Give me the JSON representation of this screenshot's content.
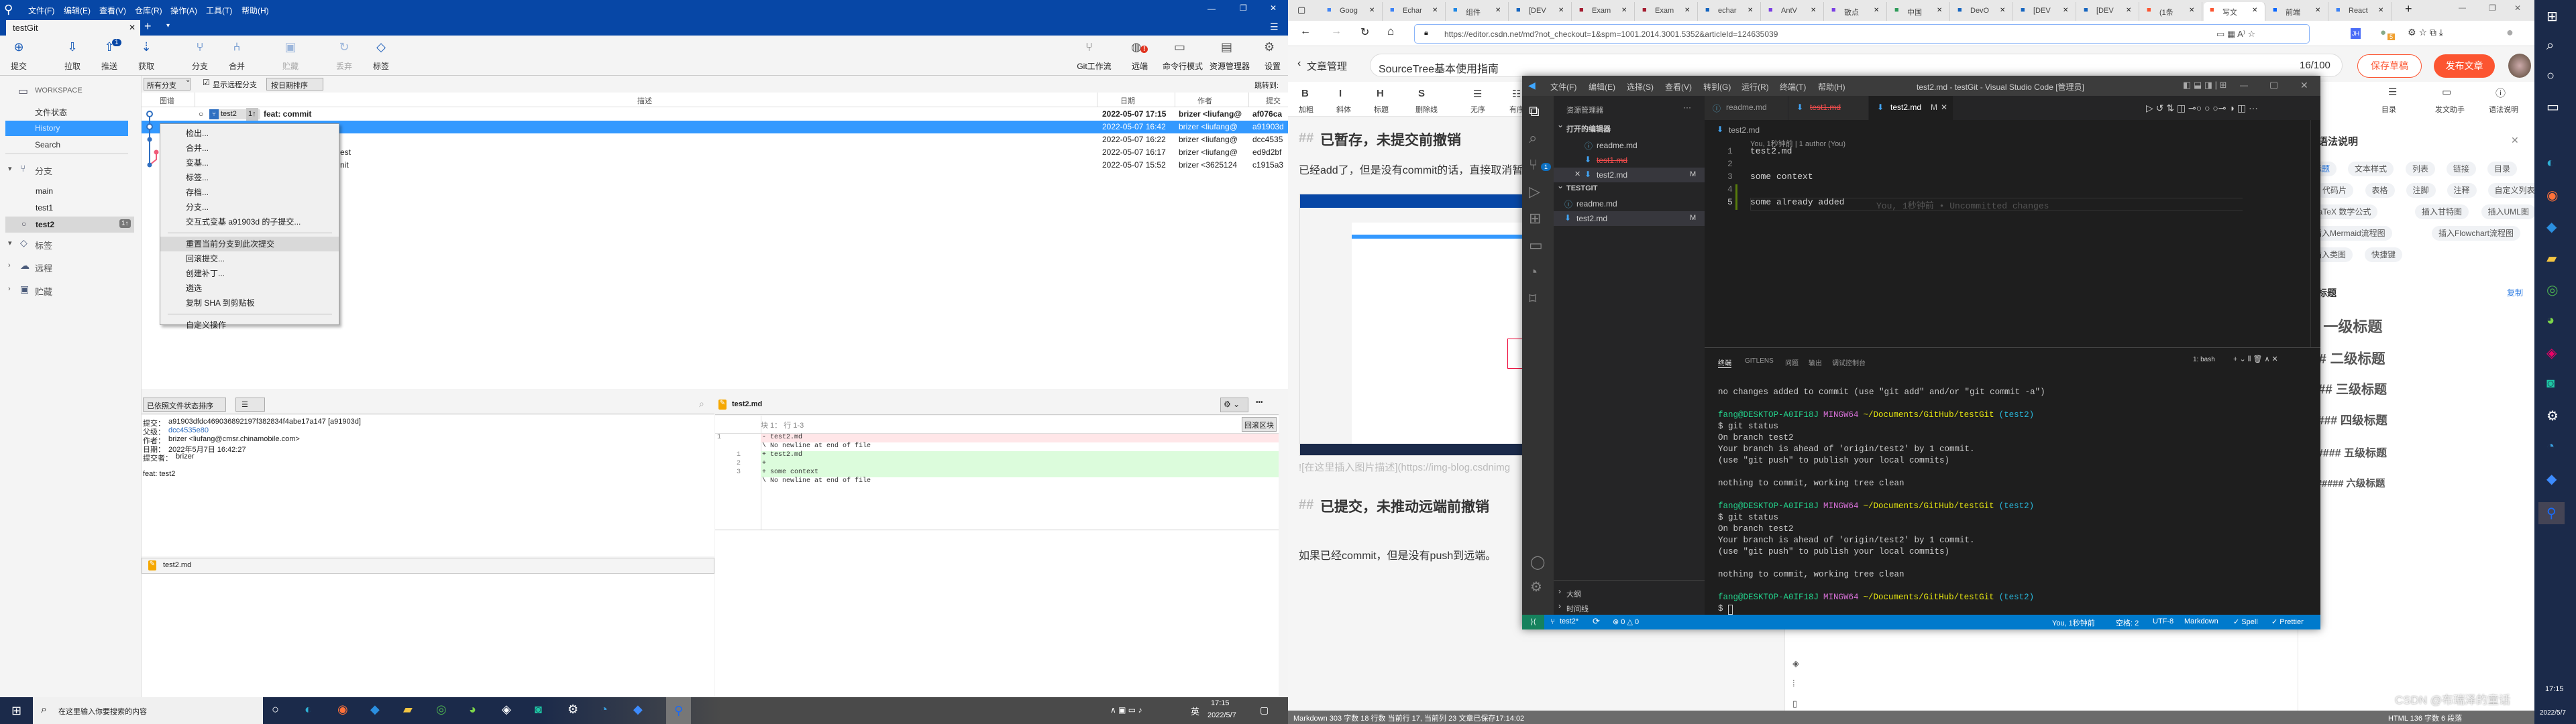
{
  "sourcetree": {
    "menu": [
      "文件(F)",
      "编辑(E)",
      "查看(V)",
      "仓库(R)",
      "操作(A)",
      "工具(T)",
      "帮助(H)"
    ],
    "tab": "testGit",
    "toolbar_left": [
      {
        "label": "提交",
        "icon": "commit-icon",
        "glyph": "⊕"
      },
      {
        "label": "拉取",
        "icon": "pull-icon",
        "glyph": "⇩"
      },
      {
        "label": "推送",
        "icon": "push-icon",
        "glyph": "⇧",
        "badge": "1"
      },
      {
        "label": "获取",
        "icon": "fetch-icon",
        "glyph": "⇣"
      },
      {
        "label": "分支",
        "icon": "branch-icon",
        "glyph": "⑂"
      },
      {
        "label": "合并",
        "icon": "merge-icon",
        "glyph": "⑃"
      },
      {
        "label": "贮藏",
        "icon": "stash-icon",
        "glyph": "▣",
        "disabled": true
      },
      {
        "label": "丢弃",
        "icon": "discard-icon",
        "glyph": "↻",
        "disabled": true
      },
      {
        "label": "标签",
        "icon": "tag-icon",
        "glyph": "◇"
      }
    ],
    "toolbar_right": [
      {
        "label": "Git工作流",
        "icon": "git-flow-icon",
        "glyph": "⑂"
      },
      {
        "label": "远端",
        "icon": "remote-icon",
        "glyph": "◍",
        "alert": "!"
      },
      {
        "label": "命令行模式",
        "icon": "terminal-icon",
        "glyph": "▭"
      },
      {
        "label": "资源管理器",
        "icon": "explorer-icon",
        "glyph": "▤"
      },
      {
        "label": "设置",
        "icon": "settings-icon",
        "glyph": "⚙"
      }
    ],
    "filter": {
      "branches": "所有分支",
      "show_remote": "显示远程分支",
      "show_remote_checked": true,
      "sort": "按日期排序",
      "jump": "跳转到:"
    },
    "columns": {
      "graph": "图谱",
      "desc": "描述",
      "date": "日期",
      "author": "作者",
      "commit": "提交"
    },
    "commits": [
      {
        "branch": "test2",
        "ahead": "1↑",
        "desc": "feat: commit",
        "date": "2022-05-07 17:15",
        "author": "brizer <liufang@",
        "hash": "af076ca",
        "bold": true
      },
      {
        "desc": "",
        "date": "2022-05-07 16:42",
        "author": "brizer <liufang@",
        "hash": "a91903d",
        "selected": true
      },
      {
        "desc": "",
        "date": "2022-05-07 16:22",
        "author": "brizer <liufang@",
        "hash": "dcc4535"
      },
      {
        "desc": "est",
        "date": "2022-05-07 16:17",
        "author": "brizer <liufang@",
        "hash": "ed9d2bf"
      },
      {
        "desc": "nit",
        "date": "2022-05-07 15:52",
        "author": "brizer <3625124",
        "hash": "c1915a3"
      }
    ],
    "sidebar": {
      "workspace": "WORKSPACE",
      "workspace_items": [
        "文件状态",
        "History",
        "Search"
      ],
      "active": "History",
      "branches_label": "分支",
      "branches": [
        "main",
        "test1",
        "test2"
      ],
      "current_branch": "test2",
      "current_ahead": "1↑",
      "tags_label": "标签",
      "remotes_label": "远程",
      "stashes_label": "贮藏"
    },
    "context_menu": {
      "groups": [
        [
          "检出...",
          "合并...",
          "变基...",
          "标签...",
          "存档...",
          "分支...",
          "交互式变基 a91903d 的子提交..."
        ],
        [
          "重置当前分支到此次提交",
          "回滚提交...",
          "创建补丁...",
          "遴选",
          "复制 SHA 到剪贴板"
        ],
        [
          "自定义操作"
        ]
      ],
      "highlighted": "重置当前分支到此次提交"
    },
    "details": {
      "sort": "已依照文件状态排序",
      "view_mode": "☰",
      "lines": [
        {
          "label": "提交：",
          "value": "a91903dfdc469036892197f382834f4abe17a147 [a91903d]"
        },
        {
          "label": "父级：",
          "value": "dcc4535e80",
          "link": true
        },
        {
          "label": "作者：",
          "value": "brizer <liufang@cmsr.chinamobile.com>"
        },
        {
          "label": "日期：",
          "value": "2022年5月7日 16:42:27"
        },
        {
          "label": "提交者：",
          "value": "brizer"
        }
      ],
      "message": "feat: test2",
      "files": [
        "test2.md"
      ]
    },
    "diff": {
      "file": "test2.md",
      "hunk": "块 1： 行 1-3",
      "revert_hunk": "回滚区块",
      "lines": [
        {
          "old": "1",
          "new": "",
          "text": "- test2.md",
          "type": "del"
        },
        {
          "old": "",
          "new": "",
          "text": "\\  No newline at end of file",
          "type": "ctx"
        },
        {
          "old": "",
          "new": "1",
          "text": "+ test2.md",
          "type": "add"
        },
        {
          "old": "",
          "new": "2",
          "text": "+",
          "type": "add"
        },
        {
          "old": "",
          "new": "3",
          "text": "+ some context",
          "type": "add"
        },
        {
          "old": "",
          "new": "",
          "text": "\\  No newline at end of file",
          "type": "ctx"
        }
      ]
    }
  },
  "taskbar_left": {
    "search_placeholder": "在这里输入你要搜索的内容",
    "apps": [
      "task-view",
      "edge",
      "firefox",
      "vscode",
      "explorer",
      "chrome",
      "wechat",
      "app",
      "app2",
      "settings",
      "app3",
      "app4",
      "sourcetree"
    ],
    "ime": "英",
    "time": "17:15",
    "date": "2022/5/7"
  },
  "browser": {
    "tabs": [
      "Goog",
      "Echar",
      "组件",
      "[DEV",
      "Exam",
      "Exam",
      "echar",
      "AntV",
      "散点",
      "中国",
      "DevO",
      "[DEV",
      "[DEV",
      "(1条",
      "写文",
      "前端",
      "React"
    ],
    "active_tab": "写文",
    "url": "https://editor.csdn.net/md?not_checkout=1&spm=1001.2014.3001.5352&articleId=124635039",
    "ext_badge": "5",
    "back_label": "文章管理",
    "article_title": "SourceTree基本使用指南",
    "title_count": "16/100",
    "save_draft": "保存草稿",
    "publish": "发布文章",
    "editor_toolbar": [
      "加粗",
      "斜体",
      "标题",
      "删除线",
      "无序",
      "有序"
    ],
    "editor_toolbar_glyphs": [
      "B",
      "I",
      "H",
      "S",
      "☰",
      "☷"
    ],
    "content": {
      "h1_mark": "##",
      "h1": "已暂存，未提交前撤销",
      "p1": "已经add了，但是没有commit的话，直接取消暂",
      "img_alt": "![在这里插入图片描述](https://img-blog.csdnimg",
      "h2_mark": "##",
      "h2": "已提交，未推动远端前撤销",
      "p2": "如果已经commit，但是没有push到远端。"
    },
    "right_tools": [
      "目录",
      "发文助手",
      "语法说明"
    ],
    "syntax": {
      "title": "语法说明",
      "chips": [
        [
          "标题",
          "文本样式",
          "列表",
          "链接",
          "目录"
        ],
        [
          "代码片",
          "表格",
          "注脚",
          "注释",
          "自定义列表"
        ],
        [
          "LaTeX 数学公式",
          "插入甘特图",
          "插入UML图"
        ],
        [
          "插入Mermaid流程图",
          "插入Flowchart流程图"
        ],
        [
          "插入类图",
          "快捷键"
        ]
      ],
      "section": "标题",
      "copy": "复制",
      "headings": [
        "# 一级标题",
        "## 二级标题",
        "### 三级标题",
        "#### 四级标题",
        "##### 五级标题",
        "###### 六级标题"
      ]
    },
    "status_left": "Markdown  303 字数  18 行数  当前行 17, 当前列 23  文章已保存17:14:02",
    "status_right": "HTML  136 字数  6 段落",
    "watermark": "CSDN @布瑞泽的童话"
  },
  "vscode": {
    "menu": [
      "文件(F)",
      "编辑(E)",
      "选择(S)",
      "查看(V)",
      "转到(G)",
      "运行(R)",
      "终端(T)",
      "帮助(H)"
    ],
    "title": "test2.md - testGit - Visual Studio Code [管理员]",
    "explorer_title": "资源管理器",
    "open_editors_label": "打开的编辑器",
    "open_editors": [
      {
        "name": "readme.md",
        "icon": "info"
      },
      {
        "name": "test1.md",
        "icon": "md",
        "deleted": true
      },
      {
        "name": "test2.md",
        "icon": "md",
        "badge": "M",
        "active": true
      }
    ],
    "folder": "TESTGIT",
    "folder_files": [
      {
        "name": "readme.md",
        "icon": "info"
      },
      {
        "name": "test2.md",
        "icon": "md",
        "badge": "M"
      }
    ],
    "outline": "大纲",
    "timeline": "时间线",
    "scm_badge": "1",
    "tabs": [
      {
        "name": "readme.md",
        "icon": "info"
      },
      {
        "name": "test1.md",
        "icon": "md",
        "deleted": true
      },
      {
        "name": "test2.md",
        "icon": "md",
        "badge": "M",
        "active": true
      }
    ],
    "breadcrumb": "test2.md",
    "blame_header": "You, 1秒钟前 | 1 author (You)",
    "code": [
      "test2.md",
      "",
      "some context",
      "",
      "some already added"
    ],
    "inline_blame": "You, 1秒钟前 • Uncommitted changes",
    "panel_tabs": [
      "终端",
      "GITLENS",
      "问题",
      "输出",
      "调试控制台"
    ],
    "terminal_select": "1: bash",
    "terminal": [
      {
        "t": "no changes added to commit (use \"git add\" and/or \"git commit -a\")"
      },
      {
        "t": ""
      },
      {
        "prompt": true
      },
      {
        "t": "$ git status"
      },
      {
        "t": "On branch test2"
      },
      {
        "t": "Your branch is ahead of 'origin/test2' by 1 commit."
      },
      {
        "t": "  (use \"git push\" to publish your local commits)"
      },
      {
        "t": ""
      },
      {
        "t": "nothing to commit, working tree clean"
      },
      {
        "t": ""
      },
      {
        "prompt": true
      },
      {
        "t": "$ git status"
      },
      {
        "t": "On branch test2"
      },
      {
        "t": "Your branch is ahead of 'origin/test2' by 1 commit."
      },
      {
        "t": "  (use \"git push\" to publish your local commits)"
      },
      {
        "t": ""
      },
      {
        "t": "nothing to commit, working tree clean"
      },
      {
        "t": ""
      },
      {
        "prompt": true
      },
      {
        "t": "$ ",
        "cursor": true
      }
    ],
    "prompt": {
      "user": "fang@DESKTOP-A0IF18J",
      "sys": "MINGW64",
      "path": "~/Documents/GitHub/testGit",
      "branch": "(test2)"
    },
    "status": {
      "branch": "test2*",
      "problems": "⊗ 0 △ 0",
      "blame": "You, 1秒钟前",
      "spaces": "空格: 2",
      "encoding": "UTF-8",
      "lang": "Markdown",
      "spell": "✓ Spell",
      "prettier": "✓ Prettier"
    }
  },
  "taskbar_right": {
    "time": "17:15",
    "date": "2022/5/7"
  },
  "colors": {
    "sourcetree_blue": "#0747a6",
    "selection": "#3399ff",
    "vscode_status": "#007acc",
    "csdn_red": "#fc5531"
  }
}
